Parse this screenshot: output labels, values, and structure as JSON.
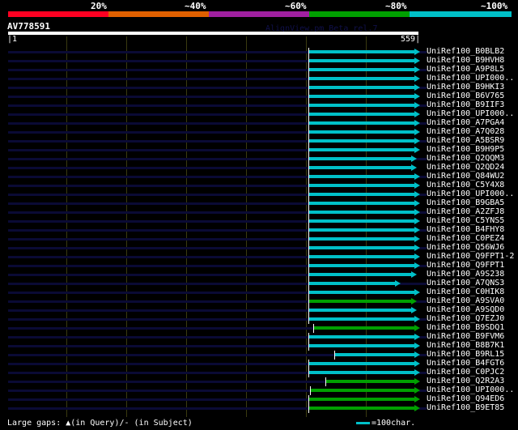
{
  "header": {
    "percent_labels": [
      "20%",
      "~40%",
      "~60%",
      "~80%",
      "~100%"
    ],
    "color_scale": [
      "#ff0022",
      "#e06000",
      "#a020a0",
      "#00a000",
      "#00c0c8"
    ]
  },
  "query": {
    "name": "AV778591",
    "start": "1",
    "end": "559",
    "length": 559
  },
  "watermark": "AlignView.pm Beta rel.7",
  "hits": [
    {
      "name": "UniRef100_B0BLB2",
      "start": 409,
      "end": 554,
      "color": "cyan"
    },
    {
      "name": "UniRef100_B9HVH8",
      "start": 409,
      "end": 554,
      "color": "cyan"
    },
    {
      "name": "UniRef100_A9P8L5",
      "start": 409,
      "end": 554,
      "color": "cyan"
    },
    {
      "name": "UniRef100_UPI000..",
      "start": 409,
      "end": 554,
      "color": "cyan"
    },
    {
      "name": "UniRef100_B9HKI3",
      "start": 409,
      "end": 554,
      "color": "cyan"
    },
    {
      "name": "UniRef100_B6V765",
      "start": 409,
      "end": 554,
      "color": "cyan"
    },
    {
      "name": "UniRef100_B9IIF3",
      "start": 409,
      "end": 554,
      "color": "cyan"
    },
    {
      "name": "UniRef100_UPI000..",
      "start": 409,
      "end": 554,
      "color": "cyan"
    },
    {
      "name": "UniRef100_A7PGA4",
      "start": 409,
      "end": 554,
      "color": "cyan"
    },
    {
      "name": "UniRef100_A7Q028",
      "start": 409,
      "end": 554,
      "color": "cyan"
    },
    {
      "name": "UniRef100_A5BSR9",
      "start": 409,
      "end": 554,
      "color": "cyan"
    },
    {
      "name": "UniRef100_B9H9P5",
      "start": 409,
      "end": 554,
      "color": "cyan"
    },
    {
      "name": "UniRef100_Q2QQM3",
      "start": 409,
      "end": 549,
      "color": "cyan"
    },
    {
      "name": "UniRef100_Q2QD24",
      "start": 409,
      "end": 549,
      "color": "cyan"
    },
    {
      "name": "UniRef100_Q84WU2",
      "start": 409,
      "end": 554,
      "color": "cyan"
    },
    {
      "name": "UniRef100_C5Y4X8",
      "start": 409,
      "end": 554,
      "color": "cyan"
    },
    {
      "name": "UniRef100_UPI000..",
      "start": 409,
      "end": 554,
      "color": "cyan"
    },
    {
      "name": "UniRef100_B9GBA5",
      "start": 409,
      "end": 554,
      "color": "cyan"
    },
    {
      "name": "UniRef100_A2ZFJ8",
      "start": 409,
      "end": 554,
      "color": "cyan"
    },
    {
      "name": "UniRef100_C5YNS5",
      "start": 409,
      "end": 554,
      "color": "cyan"
    },
    {
      "name": "UniRef100_B4FHY8",
      "start": 409,
      "end": 554,
      "color": "cyan"
    },
    {
      "name": "UniRef100_C0PEZ4",
      "start": 409,
      "end": 554,
      "color": "cyan"
    },
    {
      "name": "UniRef100_Q56WJ6",
      "start": 409,
      "end": 554,
      "color": "cyan"
    },
    {
      "name": "UniRef100_Q9FPT1-2",
      "start": 409,
      "end": 554,
      "color": "cyan"
    },
    {
      "name": "UniRef100_Q9FPT1",
      "start": 409,
      "end": 554,
      "color": "cyan"
    },
    {
      "name": "UniRef100_A9S238",
      "start": 409,
      "end": 549,
      "color": "cyan"
    },
    {
      "name": "UniRef100_A7QNS3",
      "start": 409,
      "end": 527,
      "color": "cyan"
    },
    {
      "name": "UniRef100_C0HIK8",
      "start": 409,
      "end": 554,
      "color": "cyan"
    },
    {
      "name": "UniRef100_A9SVA0",
      "start": 409,
      "end": 549,
      "color": "green"
    },
    {
      "name": "UniRef100_A9SQD0",
      "start": 409,
      "end": 549,
      "color": "cyan"
    },
    {
      "name": "UniRef100_Q7EZJ0",
      "start": 409,
      "end": 554,
      "color": "cyan"
    },
    {
      "name": "UniRef100_B9SDQ1",
      "start": 416,
      "end": 554,
      "color": "green"
    },
    {
      "name": "UniRef100_B9FVM6",
      "start": 409,
      "end": 554,
      "color": "cyan"
    },
    {
      "name": "UniRef100_B8B7K1",
      "start": 409,
      "end": 554,
      "color": "cyan"
    },
    {
      "name": "UniRef100_B9RL15",
      "start": 444,
      "end": 554,
      "color": "cyan"
    },
    {
      "name": "UniRef100_B4FGT6",
      "start": 409,
      "end": 554,
      "color": "cyan"
    },
    {
      "name": "UniRef100_C0PJC2",
      "start": 409,
      "end": 554,
      "color": "cyan"
    },
    {
      "name": "UniRef100_Q2R2A3",
      "start": 432,
      "end": 554,
      "color": "green"
    },
    {
      "name": "UniRef100_UPI000..",
      "start": 411,
      "end": 554,
      "color": "green"
    },
    {
      "name": "UniRef100_Q94ED6",
      "start": 409,
      "end": 554,
      "color": "green"
    },
    {
      "name": "UniRef100_B9ET85",
      "start": 409,
      "end": 554,
      "color": "green"
    }
  ],
  "colors": {
    "cyan": "#00c0c8",
    "green": "#00a000"
  },
  "footer": {
    "gaps_legend": "Large gaps: ▲(in Query)/- (in Subject)",
    "scale_legend": "=100char."
  }
}
